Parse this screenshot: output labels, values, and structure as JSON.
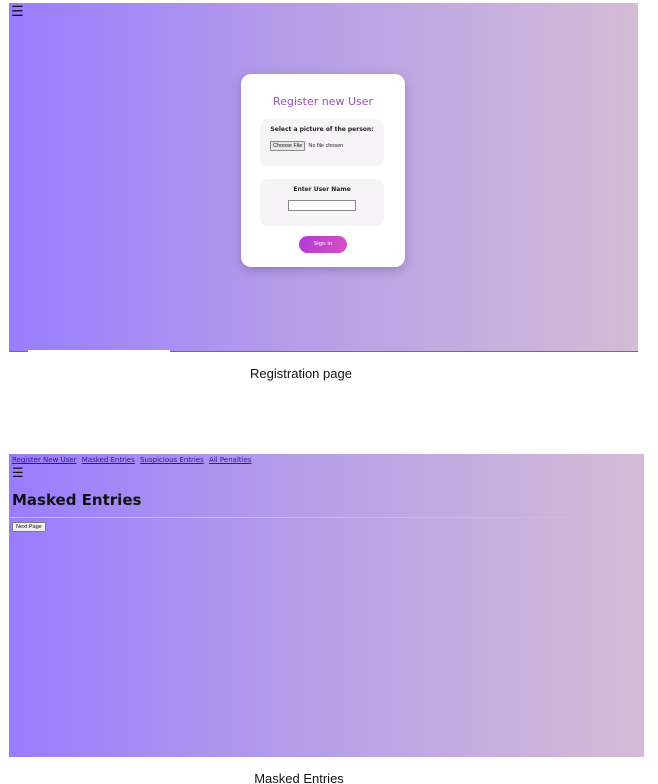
{
  "registration": {
    "menu_icon": "hamburger-menu-icon",
    "title": "Register new User",
    "picture_label": "Select a picture of the person:",
    "file_button": "Choose File",
    "file_status": "No file chosen",
    "name_label": "Enter User Name",
    "name_value": "",
    "signin_label": "Sign in",
    "caption": "Registration page"
  },
  "masked": {
    "nav": {
      "links": [
        "Register New User",
        "Masked Entries",
        "Suspicious Entries",
        "All Penalties"
      ]
    },
    "menu_icon": "hamburger-menu-icon",
    "title": "Masked Entries",
    "next_button": "Next Page",
    "caption": "Masked Entries"
  },
  "colors": {
    "gradient_start": "#9a7cff",
    "gradient_end": "#d4bcd6",
    "title_purple": "#9a4fb5",
    "button_magenta": "#b33ad2"
  }
}
